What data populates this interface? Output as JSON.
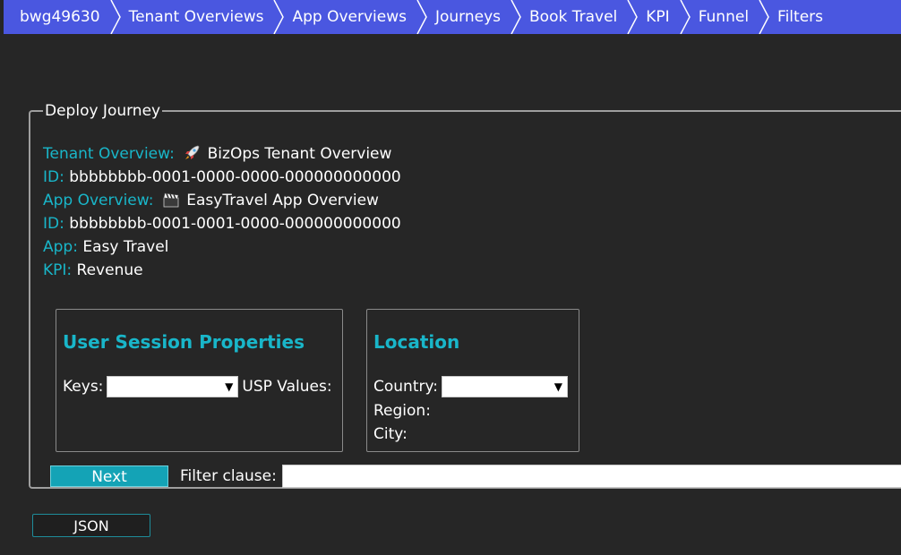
{
  "breadcrumb": [
    {
      "label": "bwg49630",
      "name": "breadcrumb-tenant-id"
    },
    {
      "label": "Tenant Overviews",
      "name": "breadcrumb-tenant-overviews"
    },
    {
      "label": "App Overviews",
      "name": "breadcrumb-app-overviews"
    },
    {
      "label": "Journeys",
      "name": "breadcrumb-journeys"
    },
    {
      "label": "Book Travel",
      "name": "breadcrumb-book-travel"
    },
    {
      "label": "KPI",
      "name": "breadcrumb-kpi"
    },
    {
      "label": "Funnel",
      "name": "breadcrumb-funnel"
    },
    {
      "label": "Filters",
      "name": "breadcrumb-filters"
    }
  ],
  "deploy": {
    "legend": "Deploy Journey",
    "tenant_overview_label": "Tenant Overview:",
    "tenant_overview_icon": "rocket-icon",
    "tenant_overview_value": "BizOps Tenant Overview",
    "tenant_id_label": "ID:",
    "tenant_id_value": "bbbbbbbb-0001-0000-0000-000000000000",
    "app_overview_label": "App Overview:",
    "app_overview_icon": "clapperboard-icon",
    "app_overview_value": "EasyTravel App Overview",
    "app_id_label": "ID:",
    "app_id_value": "bbbbbbbb-0001-0001-0000-000000000000",
    "app_label": "App:",
    "app_value": "Easy Travel",
    "kpi_label": "KPI:",
    "kpi_value": "Revenue"
  },
  "usp": {
    "title": "User Session Properties",
    "keys_label": "Keys:",
    "keys_value": "",
    "values_label": "USP Values:"
  },
  "location": {
    "title": "Location",
    "country_label": "Country:",
    "country_value": "",
    "region_label": "Region:",
    "city_label": "City:"
  },
  "actions": {
    "next_label": "Next",
    "filter_label": "Filter clause:",
    "filter_value": "",
    "json_label": "JSON"
  },
  "colors": {
    "topbar": "#4a57e0",
    "accent": "#19b6c9",
    "background": "#262626"
  }
}
